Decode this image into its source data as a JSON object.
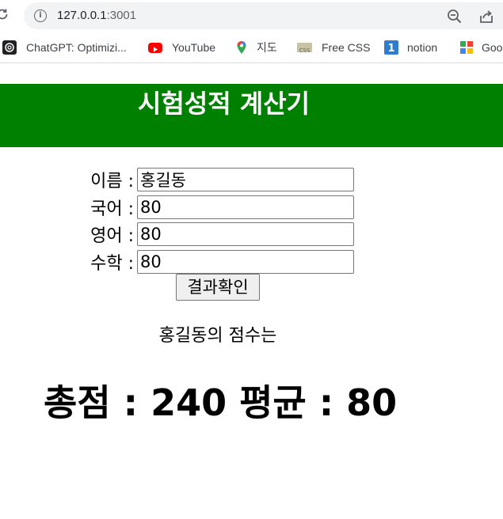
{
  "browser": {
    "url_host": "127.0.0.1",
    "url_port": ":3001",
    "bookmarks": [
      {
        "label": "ChatGPT: Optimizi...",
        "icon": "chatgpt-icon"
      },
      {
        "label": "YouTube",
        "icon": "youtube-icon"
      },
      {
        "label": "지도",
        "icon": "maps-pin-icon"
      },
      {
        "label": "Free CSS",
        "icon": "css-icon"
      },
      {
        "label": "notion",
        "icon": "notion-icon"
      },
      {
        "label": "Goo",
        "icon": "google-apps-icon"
      }
    ]
  },
  "page": {
    "title": "시험성적 계산기",
    "form": {
      "name_label": "이름 :",
      "name_value": "홍길동",
      "korean_label": "국어 :",
      "korean_value": "80",
      "english_label": "영어 :",
      "english_value": "80",
      "math_label": "수학 :",
      "math_value": "80",
      "submit_label": "결과확인"
    },
    "result": {
      "intro": "홍길동의 점수는",
      "summary": "총점 : 240 평균 : 80"
    }
  },
  "colors": {
    "header_bg": "#008000",
    "header_text": "#ffffff"
  }
}
